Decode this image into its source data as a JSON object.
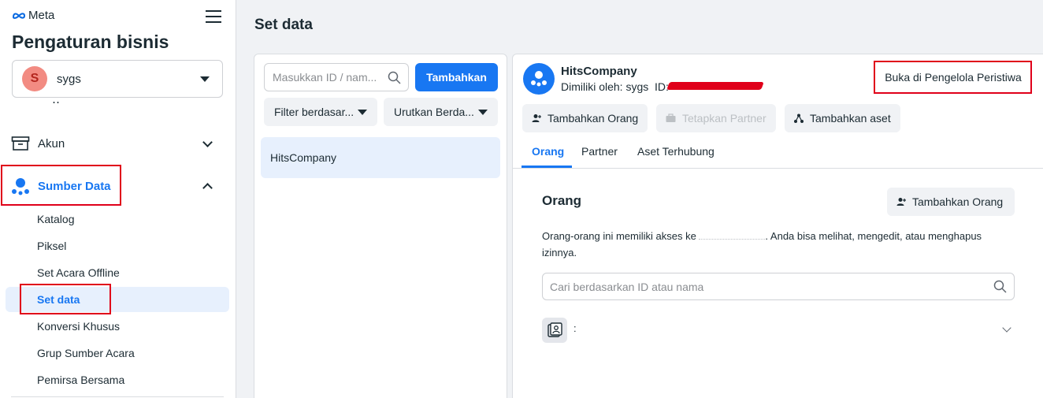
{
  "brand": {
    "logo_text": "Meta"
  },
  "sidebar": {
    "title": "Pengaturan bisnis",
    "business": {
      "initial": "S",
      "name": "sygs"
    },
    "partial_item": "‥",
    "sections": [
      {
        "label": "Akun",
        "expanded": false
      },
      {
        "label": "Sumber Data",
        "expanded": true
      }
    ],
    "sub_items": [
      "Katalog",
      "Piksel",
      "Set Acara Offline",
      "Set data",
      "Konversi Khusus",
      "Grup Sumber Acara",
      "Pemirsa Bersama"
    ],
    "active_sub_item": "Set data"
  },
  "page": {
    "title": "Set data"
  },
  "list_panel": {
    "search_placeholder": "Masukkan ID / nam...",
    "add_button": "Tambahkan",
    "filter_label": "Filter berdasar...",
    "sort_label": "Urutkan Berda...",
    "items": [
      "HitsCompany"
    ]
  },
  "detail": {
    "name": "HitsCompany",
    "owner": "Dimiliki oleh: sygs",
    "id_label": "ID:",
    "open_button": "Buka di Pengelola Peristiwa",
    "actions": [
      "Tambahkan Orang",
      "Tetapkan Partner",
      "Tambahkan aset"
    ],
    "tabs": [
      "Orang",
      "Partner",
      "Aset Terhubung"
    ],
    "active_tab": "Orang"
  },
  "people": {
    "title": "Orang",
    "add_button": "Tambahkan Orang",
    "desc_before": "Orang-orang ini memiliki akses ke",
    "desc_after": ". Anda bisa melihat, mengedit, atau menghapus izinnya.",
    "search_placeholder": "Cari berdasarkan ID atau nama",
    "rows": [
      {
        "name": ":"
      }
    ]
  },
  "colors": {
    "accent": "#1877f2",
    "highlight_box": "#e0001a",
    "active_bg": "#e7f0fd"
  }
}
